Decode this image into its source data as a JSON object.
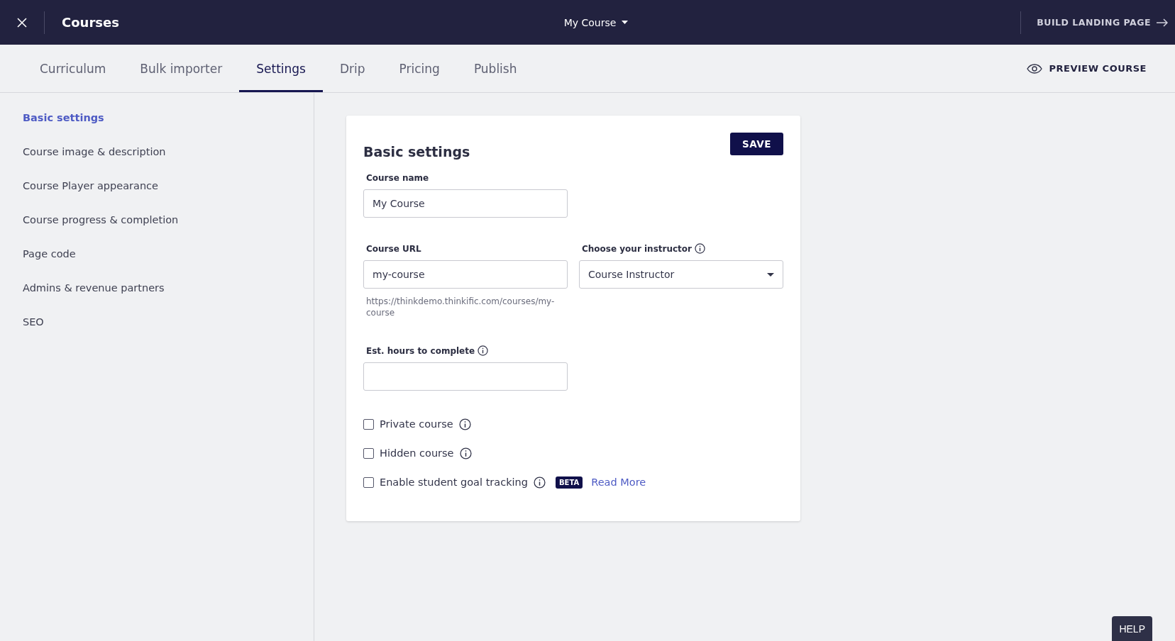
{
  "header": {
    "title": "Courses",
    "course_menu": "My Course",
    "build_link": "BUILD LANDING PAGE"
  },
  "tabs": [
    {
      "label": "Curriculum",
      "selected": false
    },
    {
      "label": "Bulk importer",
      "selected": false
    },
    {
      "label": "Settings",
      "selected": true
    },
    {
      "label": "Drip",
      "selected": false
    },
    {
      "label": "Pricing",
      "selected": false
    },
    {
      "label": "Publish",
      "selected": false
    }
  ],
  "preview_button": "PREVIEW COURSE",
  "sidebar": {
    "items": [
      {
        "label": "Basic settings",
        "selected": true
      },
      {
        "label": "Course image & description",
        "selected": false
      },
      {
        "label": "Course Player appearance",
        "selected": false
      },
      {
        "label": "Course progress & completion",
        "selected": false
      },
      {
        "label": "Page code",
        "selected": false
      },
      {
        "label": "Admins & revenue partners",
        "selected": false
      },
      {
        "label": "SEO",
        "selected": false
      }
    ]
  },
  "card": {
    "title": "Basic settings",
    "save_button": "SAVE",
    "course_name": {
      "label": "Course name",
      "value": "My Course"
    },
    "course_url": {
      "label": "Course URL",
      "value": "my-course",
      "hint": "https://thinkdemo.thinkific.com/courses/my-course"
    },
    "instructor": {
      "label": "Choose your instructor",
      "value": "Course Instructor"
    },
    "hours": {
      "label": "Est. hours to complete"
    },
    "options": [
      {
        "label": "Private course",
        "checked": false
      },
      {
        "label": "Hidden course",
        "checked": false
      },
      {
        "label": "Enable student goal tracking",
        "checked": false,
        "badge": "BETA",
        "link": "Read More"
      }
    ]
  },
  "help_button": "HELP"
}
